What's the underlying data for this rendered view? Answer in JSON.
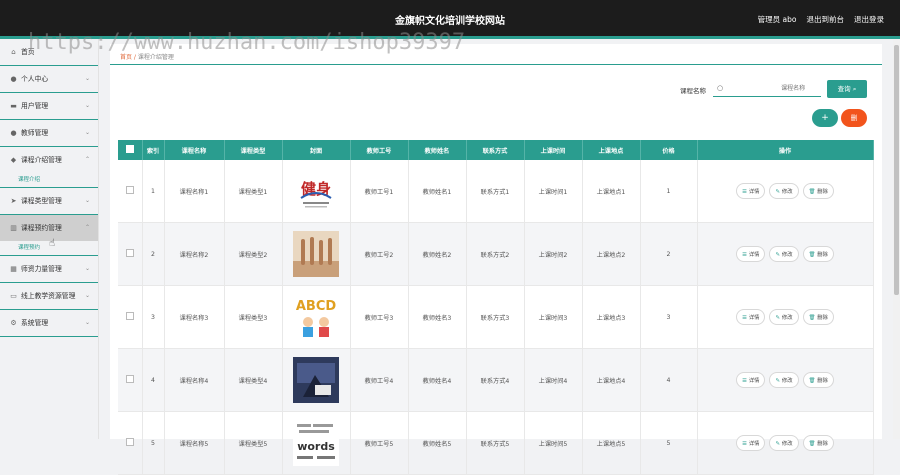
{
  "header": {
    "title": "金旗帜文化培训学校网站",
    "admin": "管理员 abo",
    "back_home": "退出到前台",
    "logout": "退出登录"
  },
  "watermark": "https://www.huzhan.com/ishop39397",
  "sidebar": {
    "items": [
      {
        "label": "首页",
        "icon": "home-icon"
      },
      {
        "label": "个人中心",
        "icon": "user-icon"
      },
      {
        "label": "用户管理",
        "icon": "monitor-icon"
      },
      {
        "label": "教师管理",
        "icon": "user-icon"
      },
      {
        "label": "课程介绍管理",
        "icon": "shield-icon"
      },
      {
        "label": "课程类型管理",
        "icon": "send-icon"
      },
      {
        "label": "课程预约管理",
        "icon": "chart-icon"
      },
      {
        "label": "师资力量管理",
        "icon": "calendar-icon"
      },
      {
        "label": "线上教学资源管理",
        "icon": "card-icon"
      },
      {
        "label": "系统管理",
        "icon": "settings-icon"
      }
    ],
    "sub_items": {
      "course_intro": "课程介绍",
      "course_booking": "课程预约"
    }
  },
  "breadcrumb": {
    "home": "首页",
    "current": "课程介绍管理"
  },
  "search": {
    "label": "课程名称",
    "placeholder": "课程名称",
    "button": "查询"
  },
  "actions": {
    "add": "+",
    "delete": "删"
  },
  "table": {
    "headers": [
      "索引",
      "课程名称",
      "课程类型",
      "封面",
      "教师工号",
      "教师姓名",
      "联系方式",
      "上课时间",
      "上课地点",
      "价格",
      "操作"
    ],
    "rows": [
      {
        "index": "1",
        "name": "课程名称1",
        "type": "课程类型1",
        "teacher_id": "教师工号1",
        "teacher_name": "教师姓名1",
        "contact": "联系方式1",
        "time": "上课时间1",
        "place": "上课地点1",
        "price": "1"
      },
      {
        "index": "2",
        "name": "课程名称2",
        "type": "课程类型2",
        "teacher_id": "教师工号2",
        "teacher_name": "教师姓名2",
        "contact": "联系方式2",
        "time": "上课时间2",
        "place": "上课地点2",
        "price": "2"
      },
      {
        "index": "3",
        "name": "课程名称3",
        "type": "课程类型3",
        "teacher_id": "教师工号3",
        "teacher_name": "教师姓名3",
        "contact": "联系方式3",
        "time": "上课时间3",
        "place": "上课地点3",
        "price": "3"
      },
      {
        "index": "4",
        "name": "课程名称4",
        "type": "课程类型4",
        "teacher_id": "教师工号4",
        "teacher_name": "教师姓名4",
        "contact": "联系方式4",
        "time": "上课时间4",
        "place": "上课地点4",
        "price": "4"
      },
      {
        "index": "5",
        "name": "课程名称5",
        "type": "课程类型5",
        "teacher_id": "教师工号5",
        "teacher_name": "教师姓名5",
        "contact": "联系方式5",
        "time": "上课时间5",
        "place": "上课地点5",
        "price": "5"
      }
    ],
    "ops": {
      "detail": "详情",
      "edit": "修改",
      "delete": "删除"
    },
    "cover_texts": {
      "c1": "健身",
      "c3": "ABCD",
      "c5": "words"
    }
  },
  "colors": {
    "accent": "#2a9d8f",
    "danger": "#f2541c",
    "topbar": "#1c1c1c"
  }
}
